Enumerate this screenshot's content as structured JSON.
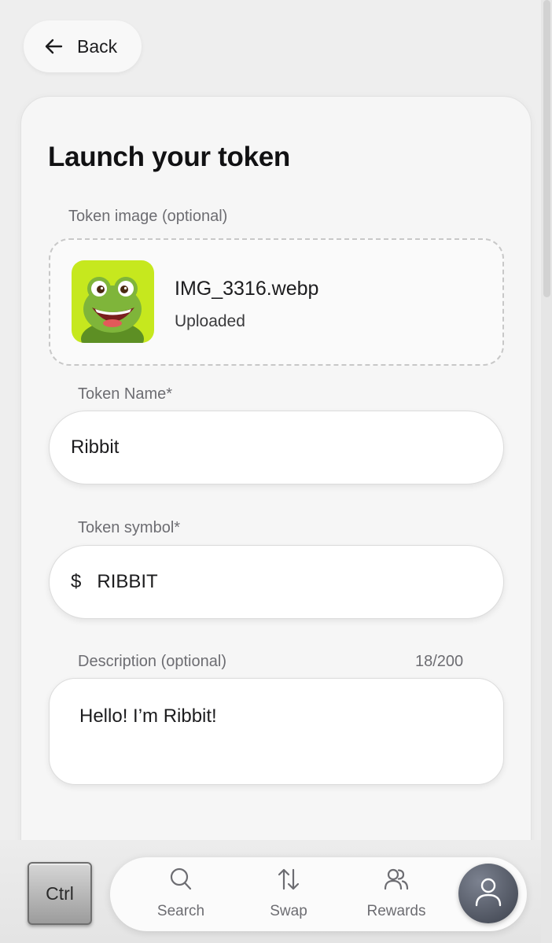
{
  "header": {
    "back_label": "Back"
  },
  "form": {
    "title": "Launch your token",
    "token_image": {
      "label": "Token image (optional)",
      "file_name": "IMG_3316.webp",
      "status": "Uploaded"
    },
    "token_name": {
      "label": "Token Name*",
      "value": "Ribbit"
    },
    "token_symbol": {
      "label": "Token symbol*",
      "prefix": "$",
      "value": "RIBBIT"
    },
    "description": {
      "label": "Description (optional)",
      "counter": "18/200",
      "value": "Hello! I’m Ribbit!"
    }
  },
  "keyboard_overlay": {
    "ctrl_label": "Ctrl"
  },
  "bottom_nav": {
    "items": [
      {
        "label": "Search",
        "icon": "search-icon"
      },
      {
        "label": "Swap",
        "icon": "swap-icon"
      },
      {
        "label": "Rewards",
        "icon": "rewards-icon"
      }
    ],
    "profile_icon": "user-icon"
  },
  "colors": {
    "background": "#eeeeee",
    "thumb_background": "#c6e81e",
    "profile_button": "#4a4f5a"
  }
}
